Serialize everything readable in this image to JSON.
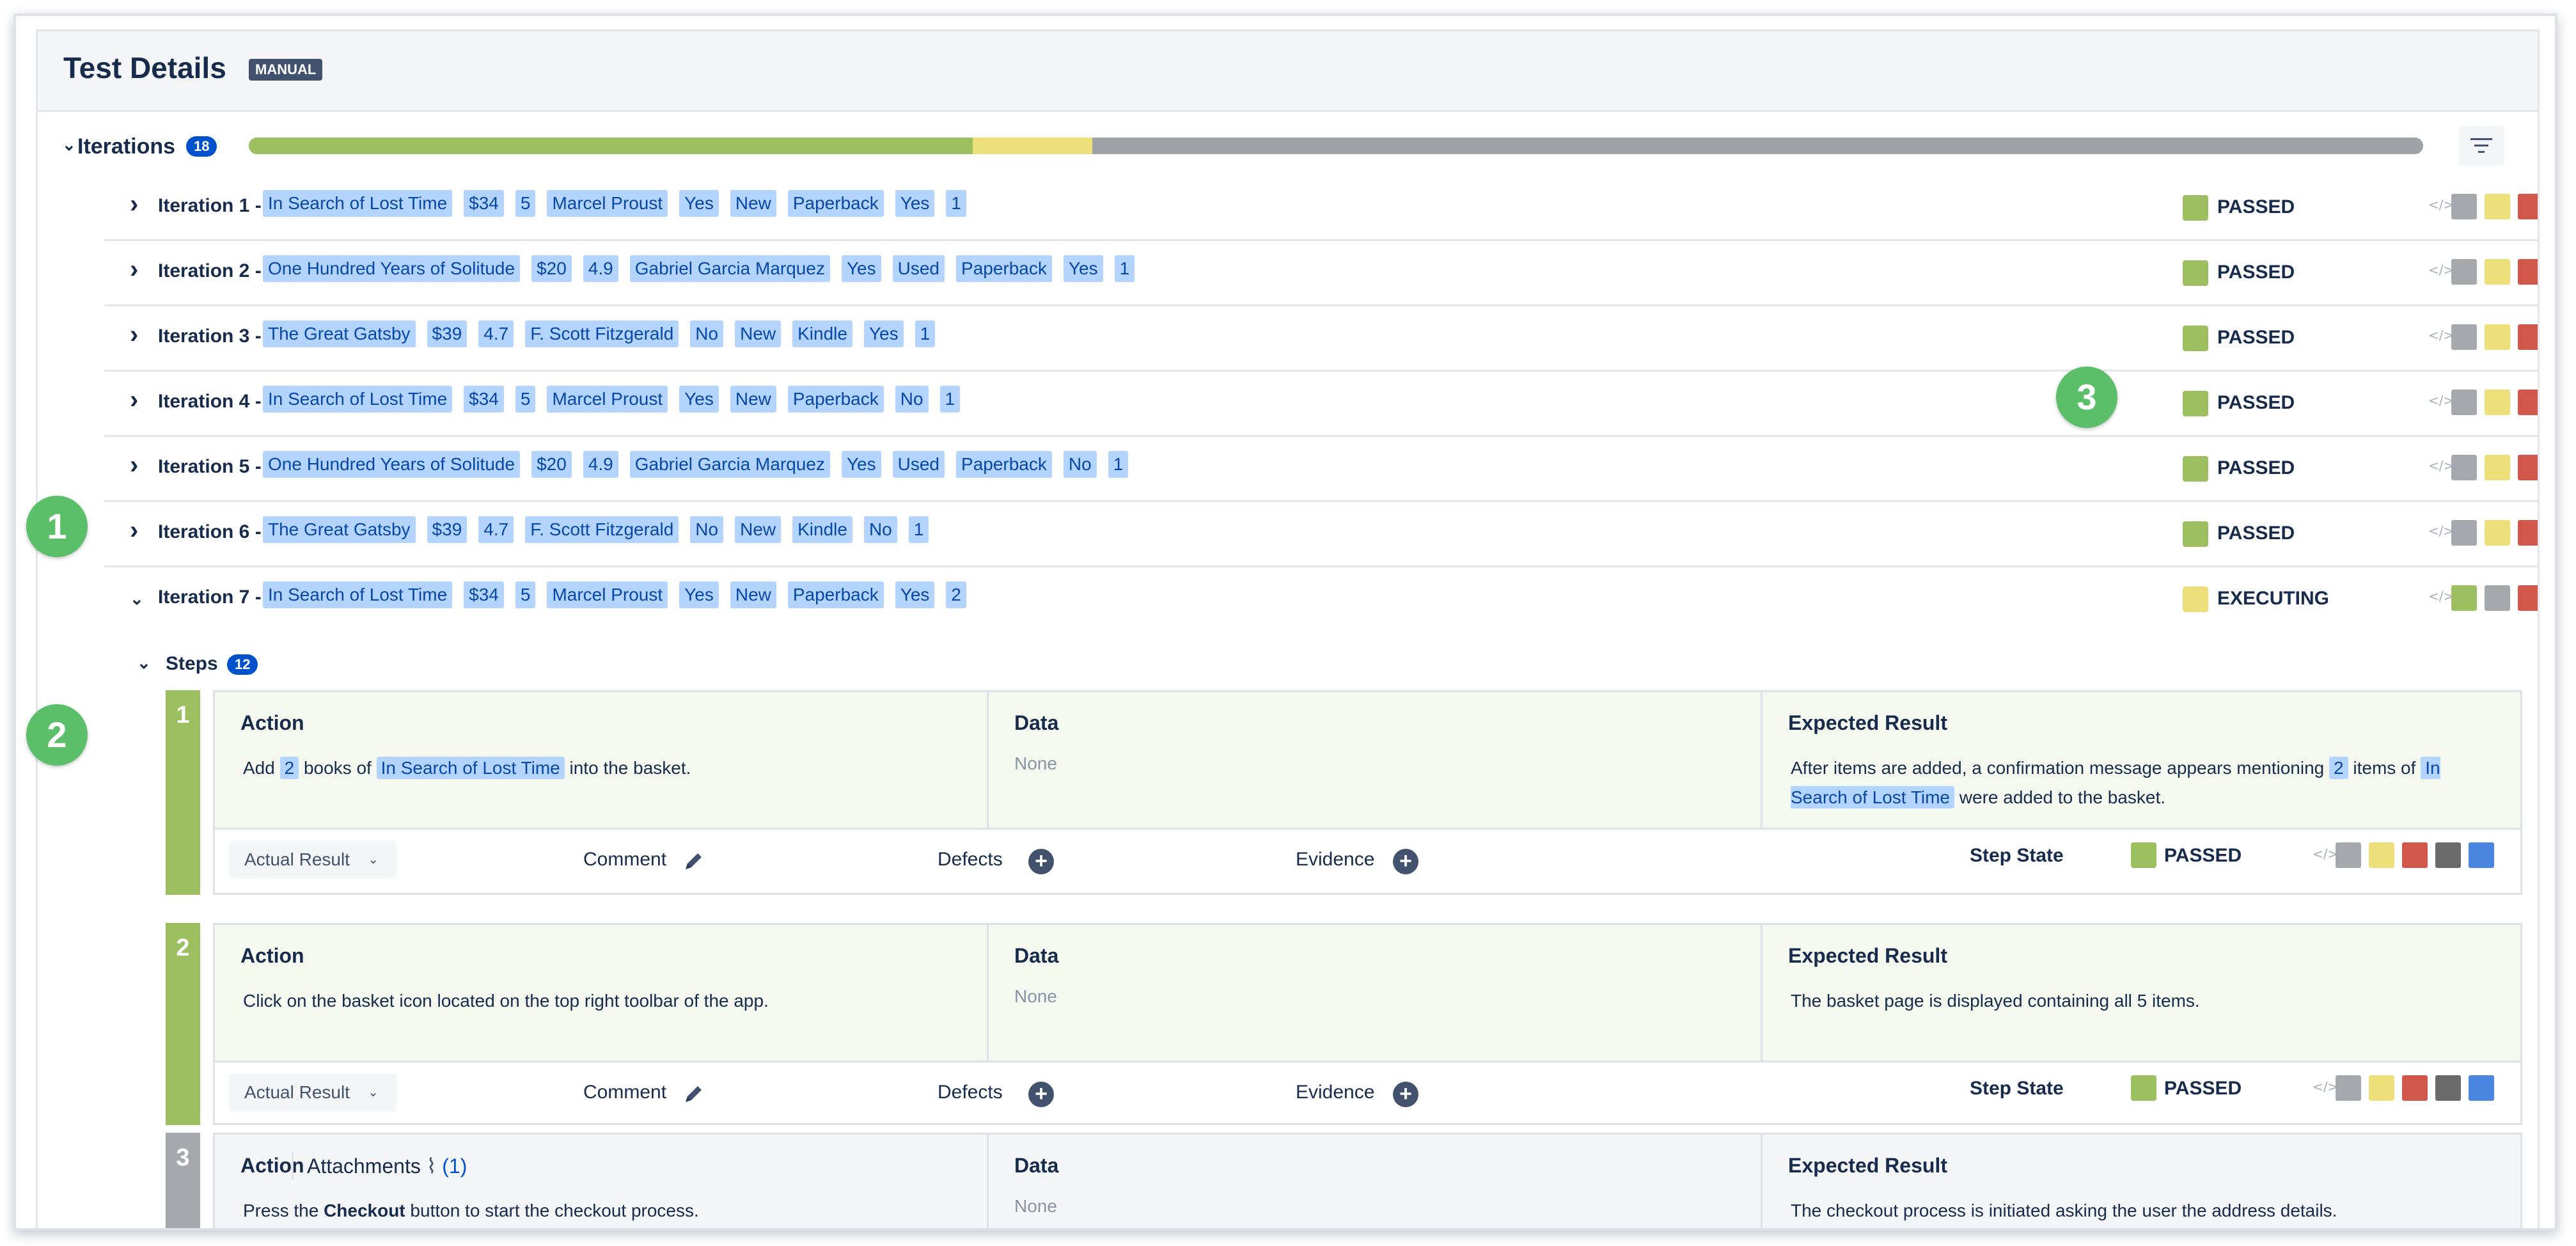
{
  "page": {
    "title": "Test Details",
    "type_badge": "MANUAL"
  },
  "iterations": {
    "label": "Iterations",
    "count": "18",
    "progress": [
      {
        "status": "passed",
        "fraction": 0.333,
        "color": "#9cbf60"
      },
      {
        "status": "executing",
        "fraction": 0.055,
        "color": "#ede07a"
      },
      {
        "status": "todo",
        "fraction": 0.612,
        "color": "#9fa3a8"
      }
    ],
    "rows": [
      {
        "label": "Iteration 1 -",
        "tags": [
          "In Search of Lost Time",
          "$34",
          "5",
          "Marcel Proust",
          "Yes",
          "New",
          "Paperback",
          "Yes",
          "1"
        ],
        "status": "PASSED",
        "status_color": "#9cbf60",
        "mini": [
          "#a5a9ae",
          "#ede07a",
          "#d1574a",
          "#2559d6",
          "#4e4e4e"
        ],
        "expanded": false
      },
      {
        "label": "Iteration 2 -",
        "tags": [
          "One Hundred Years of Solitude",
          "$20",
          "4.9",
          "Gabriel Garcia Marquez",
          "Yes",
          "Used",
          "Paperback",
          "Yes",
          "1"
        ],
        "status": "PASSED",
        "status_color": "#9cbf60",
        "mini": [
          "#a5a9ae",
          "#ede07a",
          "#d1574a",
          "#2559d6",
          "#4e4e4e"
        ],
        "expanded": false
      },
      {
        "label": "Iteration 3 -",
        "tags": [
          "The Great Gatsby",
          "$39",
          "4.7",
          "F. Scott Fitzgerald",
          "No",
          "New",
          "Kindle",
          "Yes",
          "1"
        ],
        "status": "PASSED",
        "status_color": "#9cbf60",
        "mini": [
          "#a5a9ae",
          "#ede07a",
          "#d1574a",
          "#2559d6",
          "#4e4e4e"
        ],
        "expanded": false
      },
      {
        "label": "Iteration 4 -",
        "tags": [
          "In Search of Lost Time",
          "$34",
          "5",
          "Marcel Proust",
          "Yes",
          "New",
          "Paperback",
          "No",
          "1"
        ],
        "status": "PASSED",
        "status_color": "#9cbf60",
        "mini": [
          "#a5a9ae",
          "#ede07a",
          "#d1574a",
          "#2559d6",
          "#4e4e4e"
        ],
        "expanded": false
      },
      {
        "label": "Iteration 5 -",
        "tags": [
          "One Hundred Years of Solitude",
          "$20",
          "4.9",
          "Gabriel Garcia Marquez",
          "Yes",
          "Used",
          "Paperback",
          "No",
          "1"
        ],
        "status": "PASSED",
        "status_color": "#9cbf60",
        "mini": [
          "#a5a9ae",
          "#ede07a",
          "#d1574a",
          "#2559d6",
          "#4e4e4e"
        ],
        "expanded": false
      },
      {
        "label": "Iteration 6 -",
        "tags": [
          "The Great Gatsby",
          "$39",
          "4.7",
          "F. Scott Fitzgerald",
          "No",
          "New",
          "Kindle",
          "No",
          "1"
        ],
        "status": "PASSED",
        "status_color": "#9cbf60",
        "mini": [
          "#a5a9ae",
          "#ede07a",
          "#d1574a",
          "#2559d6",
          "#4e4e4e"
        ],
        "expanded": false
      },
      {
        "label": "Iteration 7 -",
        "tags": [
          "In Search of Lost Time",
          "$34",
          "5",
          "Marcel Proust",
          "Yes",
          "New",
          "Paperback",
          "Yes",
          "2"
        ],
        "status": "EXECUTING",
        "status_color": "#ede07a",
        "mini": [
          "#9cbf60",
          "#a5a9ae",
          "#d1574a",
          "#2559d6",
          "#4e4e4e"
        ],
        "expanded": true
      }
    ]
  },
  "steps": {
    "label": "Steps",
    "count": "12",
    "items": [
      {
        "number": "1",
        "bar_color": "#9cbf60",
        "bg": "#f4f8ee",
        "action_head": "Action",
        "data_head": "Data",
        "expected_head": "Expected Result",
        "action_parts": [
          "Add ",
          "2",
          " books of ",
          "In Search of Lost Time",
          " into the basket."
        ],
        "data_value": "None",
        "expected_parts": [
          "After items are added, a confirmation message appears mentioning ",
          "2",
          " items of ",
          "In Search of Lost Time",
          "  were added to the basket."
        ],
        "actual_result": "Actual Result",
        "comment": "Comment",
        "defects": "Defects",
        "evidence": "Evidence",
        "step_state_label": "Step State",
        "state": "PASSED",
        "state_color": "#9cbf60",
        "mini": [
          "#a5a9ae",
          "#ede07a",
          "#d1574a",
          "#6b6b6b",
          "#4a86e0"
        ]
      },
      {
        "number": "2",
        "bar_color": "#9cbf60",
        "bg": "#f4f8ee",
        "action_head": "Action",
        "data_head": "Data",
        "expected_head": "Expected Result",
        "action_text": "Click on the basket icon located on the top right toolbar of the app.",
        "data_value": "None",
        "expected_text": "The basket page is displayed containing all 5 items.",
        "actual_result": "Actual Result",
        "comment": "Comment",
        "defects": "Defects",
        "evidence": "Evidence",
        "step_state_label": "Step State",
        "state": "PASSED",
        "state_color": "#9cbf60",
        "mini": [
          "#a5a9ae",
          "#ede07a",
          "#d1574a",
          "#6b6b6b",
          "#4a86e0"
        ]
      },
      {
        "number": "3",
        "bar_color": "#a5a9ae",
        "bg": "#f4f5f7",
        "action_head": "Action",
        "attachments_label": "Attachments",
        "attachments_count": "(1)",
        "data_head": "Data",
        "expected_head": "Expected Result",
        "action_parts": [
          "Press the ",
          "Checkout",
          " button to start the checkout process."
        ],
        "data_value": "None",
        "expected_text": "The checkout process is initiated asking the user the address details."
      }
    ]
  },
  "callouts": [
    "1",
    "2",
    "3"
  ]
}
